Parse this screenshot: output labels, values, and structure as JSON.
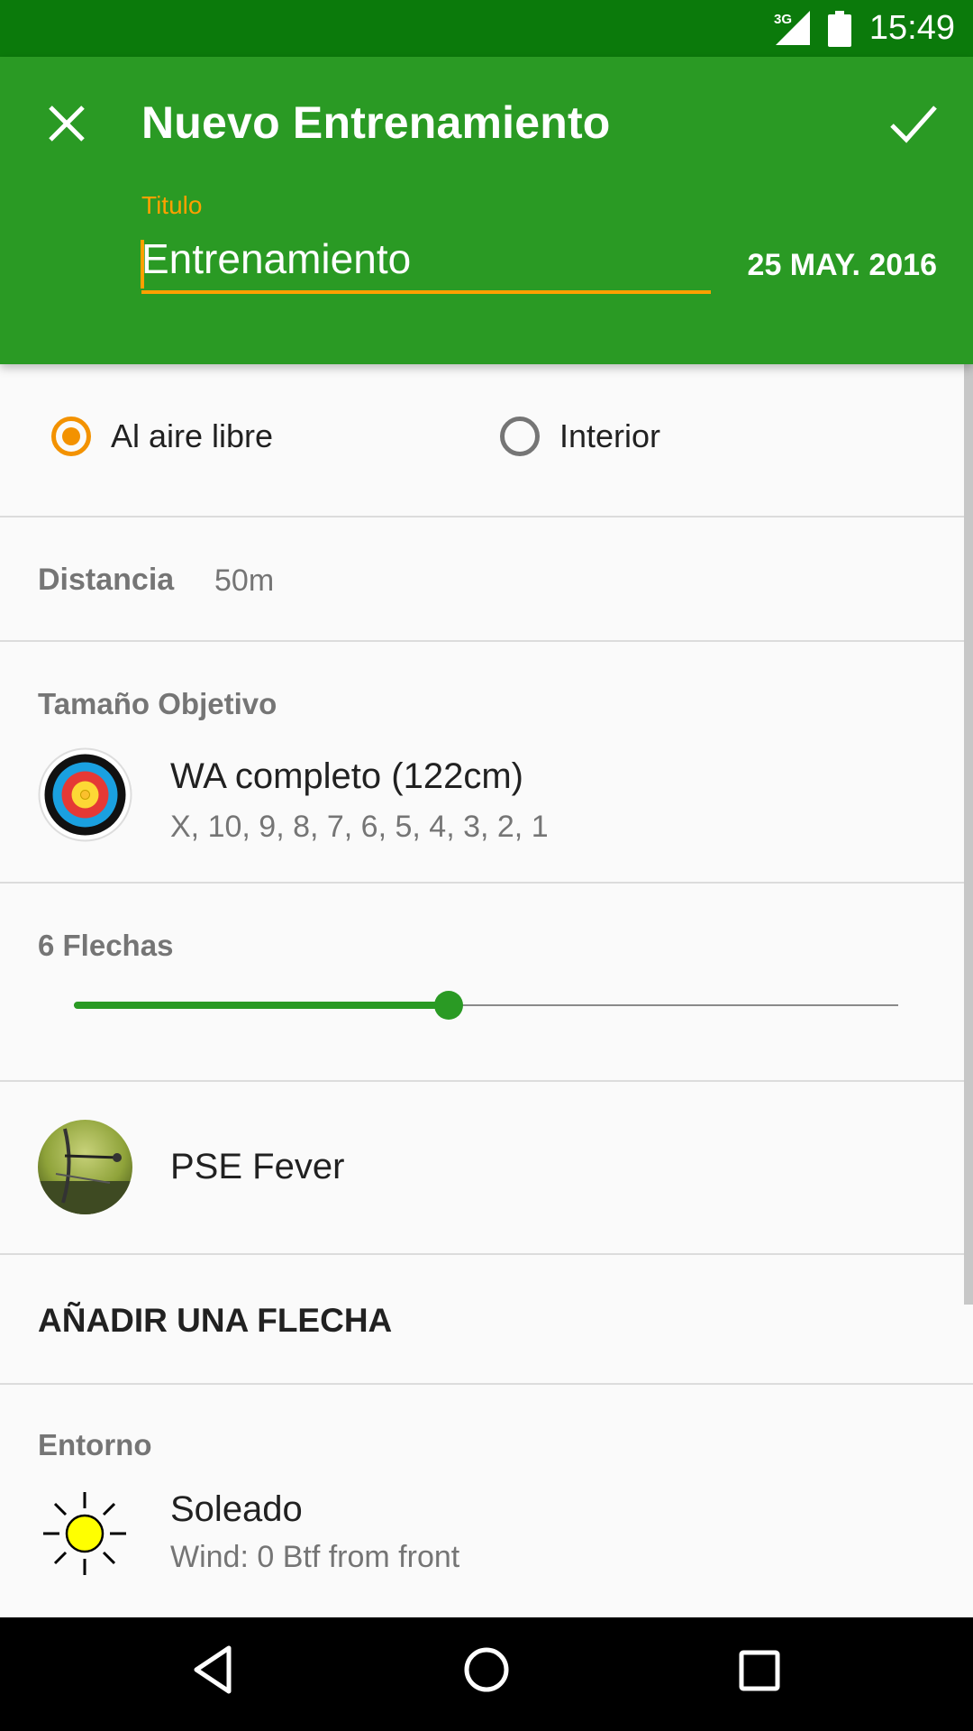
{
  "status_bar": {
    "network": "3G",
    "time": "15:49"
  },
  "app_bar": {
    "title": "Nuevo Entrenamiento",
    "title_field_label": "Titulo",
    "title_field_value": "Entrenamiento",
    "date": "25 MAY. 2016",
    "close_icon": "close-icon",
    "save_icon": "check-icon"
  },
  "environment_type": {
    "options": [
      {
        "label": "Al aire libre",
        "selected": true
      },
      {
        "label": "Interior",
        "selected": false
      }
    ]
  },
  "distance": {
    "label": "Distancia",
    "value": "50m"
  },
  "target": {
    "label": "Tamaño Objetivo",
    "name": "WA completo (122cm)",
    "scoring": "X, 10, 9, 8, 7, 6, 5, 4, 3, 2, 1"
  },
  "arrows": {
    "label": "6 Flechas",
    "slider_fraction": 0.455
  },
  "bow": {
    "name": "PSE Fever"
  },
  "add_arrow": {
    "label": "AÑADIR UNA FLECHA"
  },
  "weather": {
    "label": "Entorno",
    "condition": "Soleado",
    "wind": "Wind: 0 Btf from front"
  },
  "nav_bar": {
    "icons": [
      "back-icon",
      "home-icon",
      "recents-icon"
    ]
  },
  "colors": {
    "primary": "#2a9a24",
    "primary_dark": "#0b7a0b",
    "accent": "#f39200"
  }
}
